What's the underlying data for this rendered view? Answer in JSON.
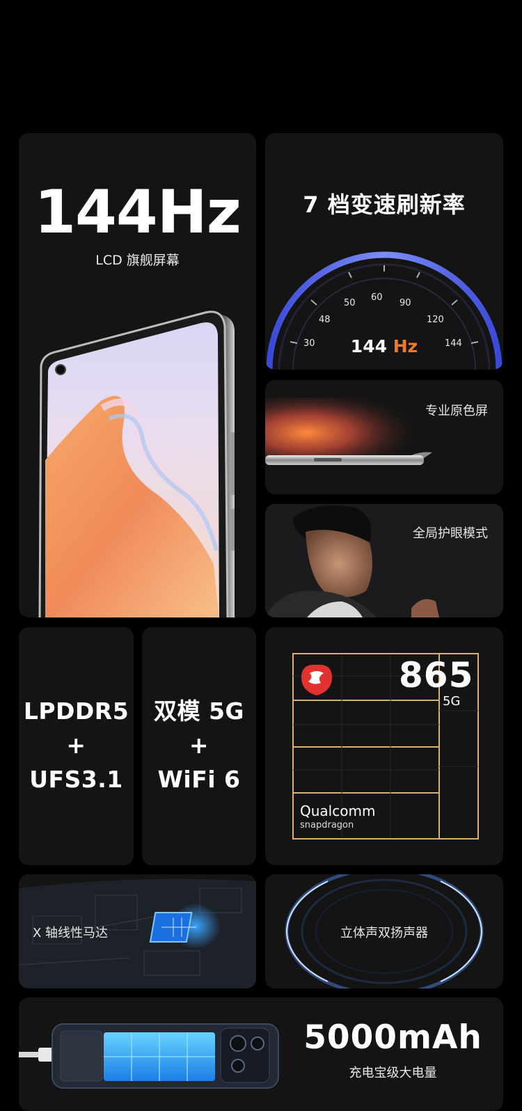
{
  "display_card": {
    "refresh": "144Hz",
    "subtitle": "LCD 旗舰屏幕"
  },
  "variable_refresh": {
    "title": "7 档变速刷新率",
    "gauge_ticks": [
      "30",
      "48",
      "50",
      "60",
      "90",
      "120",
      "144"
    ],
    "readout_value": "144",
    "readout_unit": "Hz"
  },
  "color_screen": {
    "label": "专业原色屏"
  },
  "eye_care": {
    "label": "全局护眼模式"
  },
  "memory": {
    "line1": "LPDDR5",
    "plus": "+",
    "line2": "UFS3.1"
  },
  "network": {
    "line1": "双模 5G",
    "plus": "+",
    "line2": "WiFi 6"
  },
  "chip": {
    "model": "865",
    "suffix": "5G",
    "brand": "Qualcomm",
    "brand_sub": "snapdragon"
  },
  "motor": {
    "label": "X 轴线性马达"
  },
  "speaker": {
    "label": "立体声双扬声器"
  },
  "battery": {
    "capacity": "5000mAh",
    "subtitle": "充电宝级大电量"
  },
  "colors": {
    "accent_orange": "#f07a2a",
    "gauge_blue": "#5a6cf0",
    "chip_gold": "#d8b26e",
    "card_bg": "#141414"
  }
}
